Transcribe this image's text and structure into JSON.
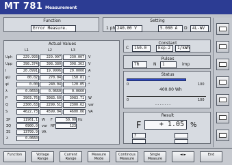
{
  "title": {
    "model": "MT 781",
    "sub": "Measurement"
  },
  "function": {
    "title": "Function",
    "value": "Error Measure."
  },
  "setting": {
    "title": "Setting",
    "voltage": "240.00 V",
    "current": "5.000 A",
    "phase_label": "1 ph",
    "mode": "4L-WV",
    "d_label": "D"
  },
  "actual": {
    "title": "Actual Values",
    "headers": [
      "L1",
      "L2",
      "L3"
    ],
    "rows": [
      {
        "label": "Uph",
        "values": [
          "229.993",
          "229.997",
          "230.007"
        ],
        "unit": "V"
      },
      {
        "label": "Upp",
        "values": [
          "398.374",
          "398.380",
          "398.363"
        ],
        "unit": "V"
      },
      {
        "label": "I",
        "values": [
          "20.0991",
          "19.9996",
          "20.0000"
        ],
        "unit": "A"
      },
      {
        "label": "φU",
        "values": [
          "00.02",
          "270.04",
          "150.01"
        ],
        "unit": "°"
      },
      {
        "label": "φI",
        "values": [
          "0.00",
          "240.04",
          "120.05"
        ],
        "unit": "°"
      },
      {
        "label": "λ",
        "values": [
          "0.0650",
          "0.0660",
          "0.0660"
        ],
        "unit": ""
      },
      {
        "label": "P",
        "values": [
          "3903.76",
          "3983.60",
          "3983.71"
        ],
        "unit": "W"
      },
      {
        "label": "Q",
        "values": [
          "2300.63",
          "2299.51",
          "2300.62"
        ],
        "unit": "var"
      },
      {
        "label": "S",
        "values": [
          "4622.73",
          "4599.04",
          "4600.06"
        ],
        "unit": "VA"
      }
    ],
    "summary": [
      {
        "label": "ΣP",
        "value": "11961.1",
        "unit": "W"
      },
      {
        "label": "ΣQ",
        "value": "6900.0",
        "unit": "var"
      },
      {
        "label": "ΣS",
        "value": "13799.9",
        "unit": "VA"
      },
      {
        "label": "λ",
        "value": "0.0660",
        "unit": ""
      }
    ],
    "freq": {
      "label": "F",
      "value": "50.00",
      "unit": "Hz"
    },
    "rf": {
      "label": "RF",
      "value": "123"
    }
  },
  "constant": {
    "title": "Constant",
    "c": "150.0",
    "exp": "Exp-2",
    "unit": "1/kWh"
  },
  "pulses": {
    "title": "Pulses",
    "mode": "TR",
    "n": "1",
    "imp": "imp"
  },
  "status": {
    "title": "Status",
    "text": "400.00 Wh",
    "left": "0",
    "right": "100",
    "progress": 0.75,
    "scale": "- - - - - - -"
  },
  "result": {
    "title": "Result",
    "label": "F",
    "value": "+ 1.05",
    "unit": "%",
    "p1": "3"
  },
  "buttons": [
    "Function",
    "Voltage Range",
    "Current Range",
    "Measure Mode",
    "Continous Measure",
    "Single Measure",
    "◄ ►",
    "End"
  ]
}
